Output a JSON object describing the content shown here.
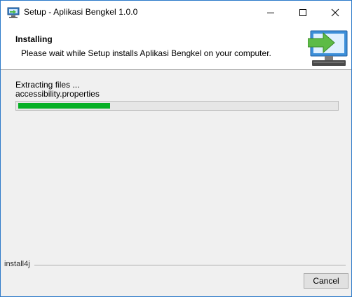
{
  "window": {
    "title": "Setup - Aplikasi Bengkel 1.0.0"
  },
  "header": {
    "title": "Installing",
    "subtitle": "Please wait while Setup installs Aplikasi Bengkel on your computer."
  },
  "progress": {
    "status": "Extracting files ...",
    "current_file": "accessibility.properties",
    "fraction": 0.29,
    "color": "#06b025"
  },
  "footer": {
    "brand": "install4j",
    "cancel_label": "Cancel"
  },
  "icons": {
    "app": "setup-app-icon",
    "header_graphic": "computer-install-arrow-icon",
    "minimize": "minimize-icon",
    "maximize": "maximize-icon",
    "close": "close-icon"
  }
}
